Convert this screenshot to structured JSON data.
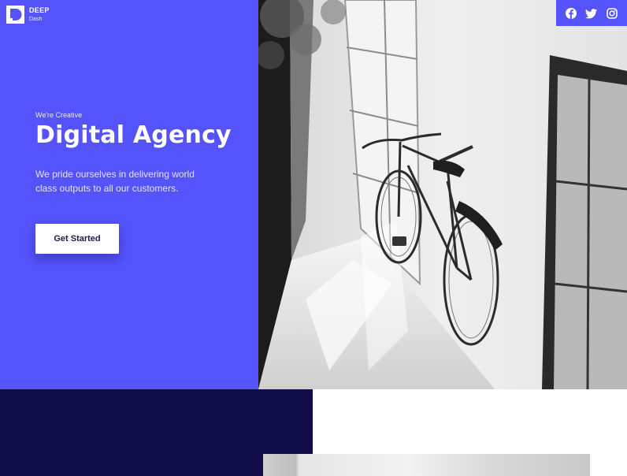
{
  "brand": {
    "name": "DEEP",
    "sub": "Dash",
    "icon": "logo-d-icon"
  },
  "hero": {
    "eyebrow": "We're Creative",
    "title": "Digital Agency",
    "description": "We pride ourselves in delivering world class outputs to all our customers.",
    "cta_label": "Get Started"
  },
  "social": [
    {
      "name": "facebook-icon"
    },
    {
      "name": "twitter-icon"
    },
    {
      "name": "instagram-icon"
    }
  ],
  "colors": {
    "primary": "#5553fb",
    "navy": "#100d48",
    "white": "#ffffff"
  }
}
